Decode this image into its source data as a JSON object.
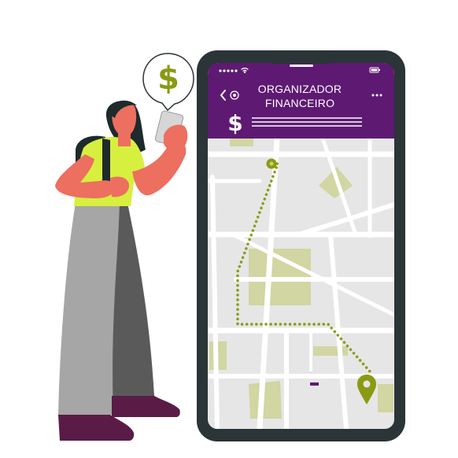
{
  "app": {
    "title_line1": "ORGANIZADOR",
    "title_line2": "FINANCEIRO",
    "currency_symbol": "$"
  },
  "bubble": {
    "symbol": "$"
  },
  "icons": {
    "back": "chevron-left-icon",
    "menu": "more-horizontal-icon",
    "signal": "signal-dots-icon",
    "wifi": "wifi-icon",
    "battery": "battery-icon",
    "location": "location-pin-icon",
    "route_start": "route-start-dot-icon"
  },
  "colors": {
    "brand_purple": "#5e1a73",
    "accent_olive": "#8a9a14",
    "map_bg": "#e6e6e6",
    "map_road": "#ffffff",
    "map_park": "#d1d6a2",
    "phone_frame": "#2b3437",
    "shirt": "#d7ef3f",
    "skin": "#ec6f5f",
    "hair": "#1e2a2c",
    "pants_front": "#a6a6a6",
    "pants_back": "#5a5a5a",
    "shoes": "#5a1c47"
  }
}
